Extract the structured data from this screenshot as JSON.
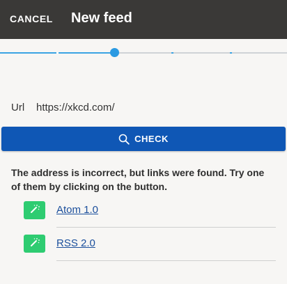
{
  "header": {
    "cancel_label": "CANCEL",
    "title": "New feed"
  },
  "stepper": {
    "current_step": 3,
    "total_steps": 5,
    "color_done": "#3aa3e3",
    "color_todo": "#cfd3d6"
  },
  "form": {
    "url_label": "Url",
    "url_value": "https://xkcd.com/",
    "check_label": "CHECK",
    "check_icon": "search-icon",
    "check_color": "#0f57b5"
  },
  "result": {
    "message": "The address is incorrect, but links were found. Try one of them by clicking on the button.",
    "links": [
      {
        "label": "Atom 1.0",
        "icon": "magic-wand-icon"
      },
      {
        "label": "RSS 2.0",
        "icon": "magic-wand-icon"
      }
    ],
    "button_color": "#2ecc71"
  }
}
